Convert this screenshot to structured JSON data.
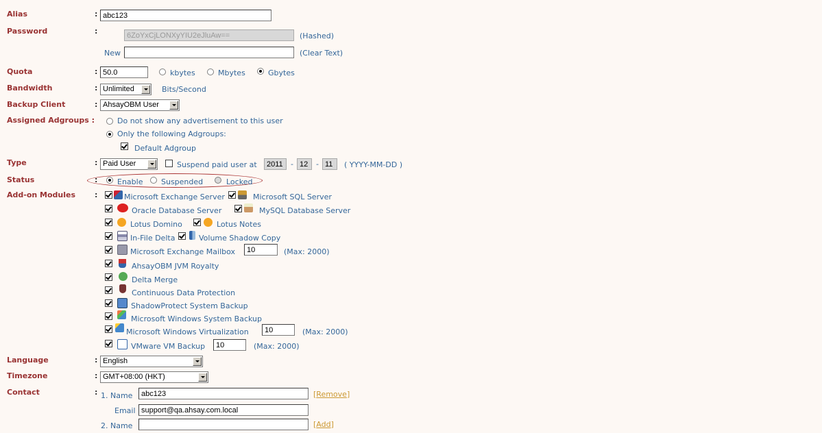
{
  "labels": {
    "alias": "Alias",
    "password": "Password",
    "quota": "Quota",
    "bandwidth": "Bandwidth",
    "backup_client": "Backup Client",
    "assigned_adgroups": "Assigned Adgroups :",
    "type": "Type",
    "status": "Status",
    "addon_modules": "Add-on Modules",
    "language": "Language",
    "timezone": "Timezone",
    "contact": "Contact"
  },
  "colon": ":",
  "alias": {
    "value": "abc123"
  },
  "password": {
    "hashed_value": "6ZoYxCjLONXyYIU2eJluAw==",
    "hashed_note": "(Hashed)",
    "new_label": "New",
    "new_value": "",
    "clear_note": "(Clear Text)"
  },
  "quota": {
    "value": "50.0",
    "units": [
      "kbytes",
      "Mbytes",
      "Gbytes"
    ],
    "selected": "Gbytes"
  },
  "bandwidth": {
    "value": "Unlimited",
    "unit": "Bits/Second"
  },
  "backup_client": {
    "value": "AhsayOBM User"
  },
  "adgroups": {
    "option1": "Do not show any advertisement to this user",
    "option2": "Only the following Adgroups:",
    "selected": "option2",
    "group": "Default Adgroup",
    "group_checked": true
  },
  "type": {
    "value": "Paid User",
    "suspend_label": "Suspend paid user at",
    "year": "2011",
    "month": "12",
    "day": "11",
    "sep": "-",
    "format": "( YYYY-MM-DD )"
  },
  "status": {
    "options": [
      "Enable",
      "Suspended",
      "Locked"
    ],
    "selected": "Enable"
  },
  "modules": [
    {
      "label": "Microsoft Exchange Server",
      "icon": "exchange-icon"
    },
    {
      "label": "Microsoft SQL Server",
      "icon": "sql-server-icon"
    },
    {
      "label": "Oracle Database Server",
      "icon": "oracle-icon"
    },
    {
      "label": "MySQL Database Server",
      "icon": "mysql-icon"
    },
    {
      "label": "Lotus Domino",
      "icon": "lotus-domino-icon"
    },
    {
      "label": "Lotus Notes",
      "icon": "lotus-notes-icon"
    },
    {
      "label": "In-File Delta",
      "icon": "delta-icon"
    },
    {
      "label": "Volume Shadow Copy",
      "icon": "shadow-copy-icon"
    },
    {
      "label": "Microsoft Exchange Mailbox",
      "icon": "mailbox-icon",
      "value": "10",
      "max": "(Max: 2000)"
    },
    {
      "label": "AhsayOBM JVM Royalty",
      "icon": "java-icon"
    },
    {
      "label": "Delta Merge",
      "icon": "merge-icon"
    },
    {
      "label": "Continuous Data Protection",
      "icon": "cdp-icon"
    },
    {
      "label": "ShadowProtect System Backup",
      "icon": "shadowprotect-icon"
    },
    {
      "label": "Microsoft Windows System Backup",
      "icon": "windows-backup-icon"
    },
    {
      "label": "Microsoft Windows Virtualization",
      "icon": "hyperv-icon",
      "value": "10",
      "max": "(Max: 2000)"
    },
    {
      "label": "VMware VM Backup",
      "icon": "vmware-icon",
      "value": "10",
      "max": "(Max: 2000)"
    }
  ],
  "language": {
    "value": "English"
  },
  "timezone": {
    "value": "GMT+08:00 (HKT)"
  },
  "contact": {
    "name1_label": "1. Name",
    "name1_value": "abc123",
    "remove": "Remove",
    "email_label": "Email",
    "email_value": "support@qa.ahsay.com.local",
    "name2_label": "2. Name",
    "name2_value": "",
    "add": "Add",
    "bracket_open": "[",
    "bracket_close": "]"
  },
  "colors": {
    "label": "#993333",
    "text": "#336699",
    "link": "#cc9933"
  }
}
